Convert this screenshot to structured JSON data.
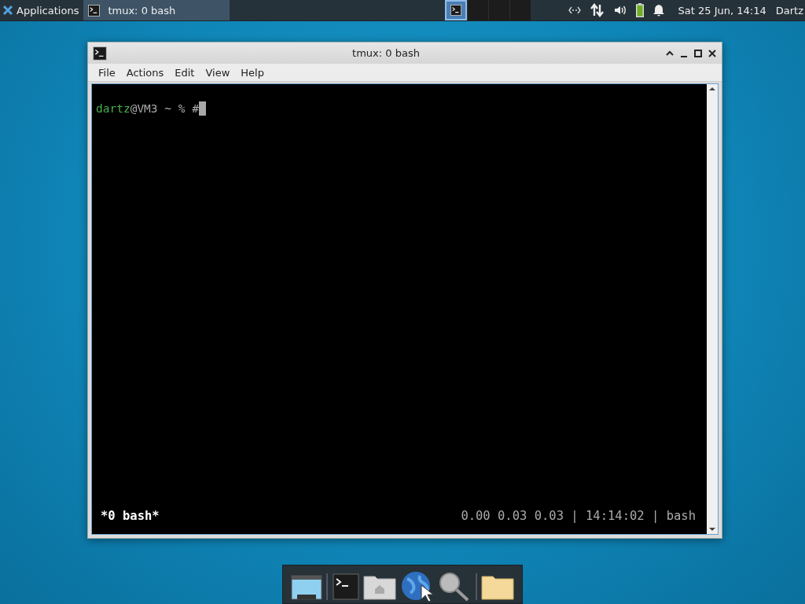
{
  "top_panel": {
    "menu_label": "Applications",
    "tasks": [
      {
        "title": "tmux: 0 bash",
        "selected": true
      }
    ],
    "workspaces": [
      {
        "selected": true
      },
      {
        "selected": false
      },
      {
        "selected": false
      },
      {
        "selected": false
      }
    ],
    "clock": "Sat 25 Jun, 14:14",
    "user": "Dartz"
  },
  "window": {
    "title": "tmux: 0 bash",
    "menu": [
      "File",
      "Actions",
      "Edit",
      "View",
      "Help"
    ],
    "prompt": {
      "user": "dartz",
      "rest": "@VM3 ~ % #"
    },
    "status_left": "*0 bash*",
    "status_right": "0.00 0.03 0.03 | 14:14:02 | bash"
  },
  "dock": {
    "items": [
      {
        "kind": "desktop"
      },
      {
        "kind": "separator"
      },
      {
        "kind": "terminal"
      },
      {
        "kind": "home"
      },
      {
        "kind": "web"
      },
      {
        "kind": "search"
      },
      {
        "kind": "separator"
      },
      {
        "kind": "folder"
      }
    ]
  }
}
